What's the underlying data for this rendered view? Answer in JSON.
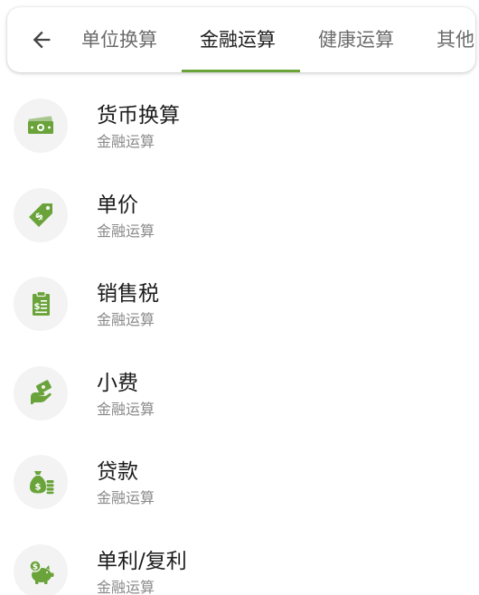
{
  "colors": {
    "accent": "#6aa33a",
    "tab_text": "#6b6b6b",
    "tab_text_active": "#1f1f1f",
    "icon_bg": "#f3f3f3",
    "subtitle": "#8a8a8a"
  },
  "header": {
    "back_icon": "arrow-left-icon",
    "active_tab_index": 1,
    "tabs": [
      {
        "label": "单位换算"
      },
      {
        "label": "金融运算"
      },
      {
        "label": "健康运算"
      },
      {
        "label": "其他"
      }
    ]
  },
  "items": [
    {
      "title": "货币换算",
      "subtitle": "金融运算",
      "icon": "money-bill-icon"
    },
    {
      "title": "单价",
      "subtitle": "金融运算",
      "icon": "price-tag-icon"
    },
    {
      "title": "销售税",
      "subtitle": "金融运算",
      "icon": "receipt-icon"
    },
    {
      "title": "小费",
      "subtitle": "金融运算",
      "icon": "tip-hand-icon"
    },
    {
      "title": "贷款",
      "subtitle": "金融运算",
      "icon": "money-bag-coins-icon"
    },
    {
      "title": "单利/复利",
      "subtitle": "金融运算",
      "icon": "piggy-bank-icon"
    }
  ]
}
